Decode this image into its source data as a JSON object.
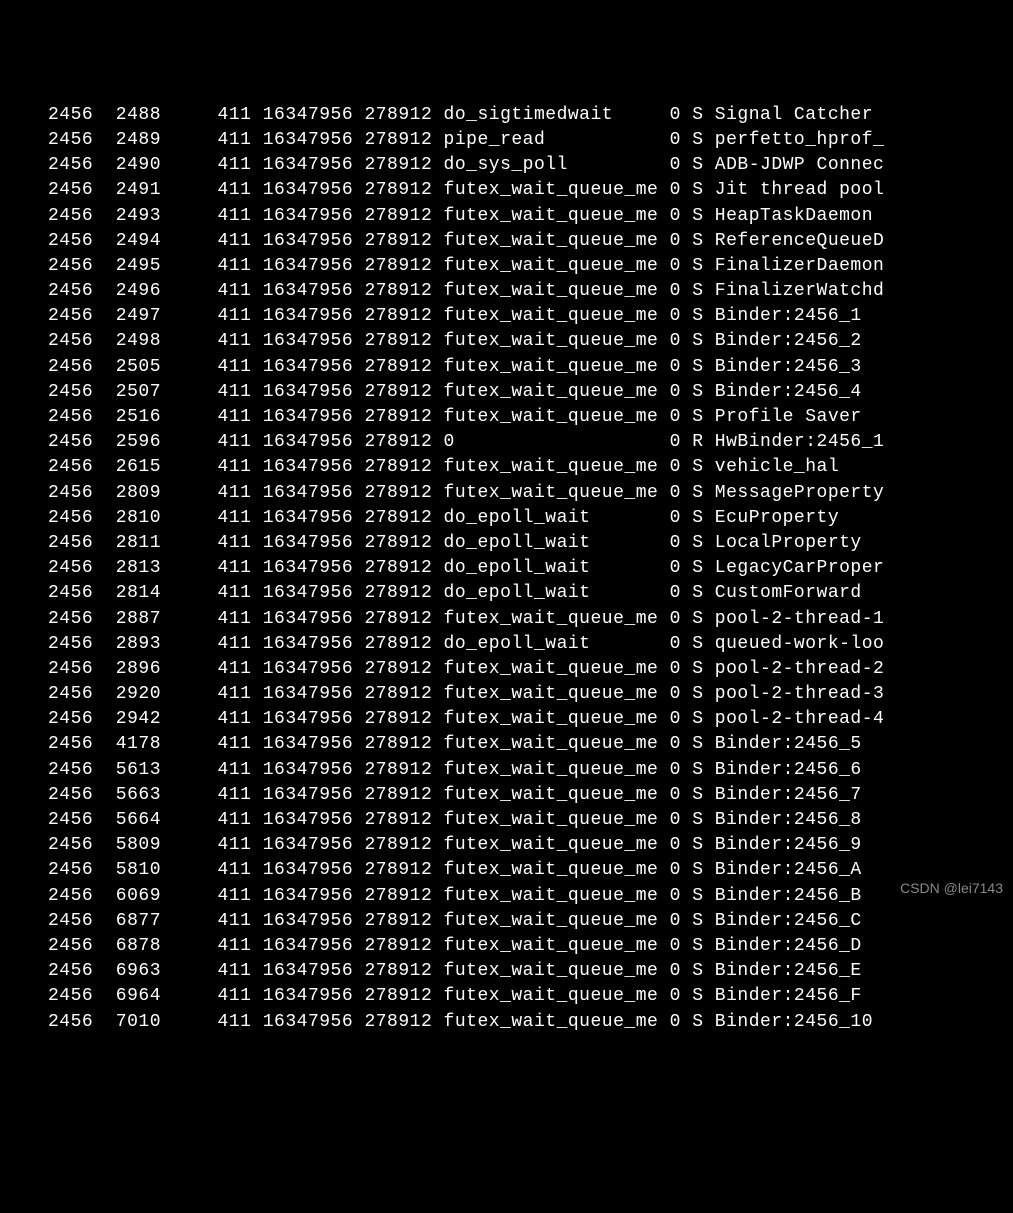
{
  "watermark": "CSDN @lei7143",
  "rows": [
    {
      "pid": "2456",
      "tid": "2488",
      "ppid": "411",
      "vsz": "16347956",
      "rss": "278912",
      "wchan": "do_sigtimedwait",
      "addr": "0",
      "stat": "S",
      "name": "Signal Catcher"
    },
    {
      "pid": "2456",
      "tid": "2489",
      "ppid": "411",
      "vsz": "16347956",
      "rss": "278912",
      "wchan": "pipe_read",
      "addr": "0",
      "stat": "S",
      "name": "perfetto_hprof_"
    },
    {
      "pid": "2456",
      "tid": "2490",
      "ppid": "411",
      "vsz": "16347956",
      "rss": "278912",
      "wchan": "do_sys_poll",
      "addr": "0",
      "stat": "S",
      "name": "ADB-JDWP Connec"
    },
    {
      "pid": "2456",
      "tid": "2491",
      "ppid": "411",
      "vsz": "16347956",
      "rss": "278912",
      "wchan": "futex_wait_queue_me",
      "addr": "0",
      "stat": "S",
      "name": "Jit thread pool"
    },
    {
      "pid": "2456",
      "tid": "2493",
      "ppid": "411",
      "vsz": "16347956",
      "rss": "278912",
      "wchan": "futex_wait_queue_me",
      "addr": "0",
      "stat": "S",
      "name": "HeapTaskDaemon"
    },
    {
      "pid": "2456",
      "tid": "2494",
      "ppid": "411",
      "vsz": "16347956",
      "rss": "278912",
      "wchan": "futex_wait_queue_me",
      "addr": "0",
      "stat": "S",
      "name": "ReferenceQueueD"
    },
    {
      "pid": "2456",
      "tid": "2495",
      "ppid": "411",
      "vsz": "16347956",
      "rss": "278912",
      "wchan": "futex_wait_queue_me",
      "addr": "0",
      "stat": "S",
      "name": "FinalizerDaemon"
    },
    {
      "pid": "2456",
      "tid": "2496",
      "ppid": "411",
      "vsz": "16347956",
      "rss": "278912",
      "wchan": "futex_wait_queue_me",
      "addr": "0",
      "stat": "S",
      "name": "FinalizerWatchd"
    },
    {
      "pid": "2456",
      "tid": "2497",
      "ppid": "411",
      "vsz": "16347956",
      "rss": "278912",
      "wchan": "futex_wait_queue_me",
      "addr": "0",
      "stat": "S",
      "name": "Binder:2456_1"
    },
    {
      "pid": "2456",
      "tid": "2498",
      "ppid": "411",
      "vsz": "16347956",
      "rss": "278912",
      "wchan": "futex_wait_queue_me",
      "addr": "0",
      "stat": "S",
      "name": "Binder:2456_2"
    },
    {
      "pid": "2456",
      "tid": "2505",
      "ppid": "411",
      "vsz": "16347956",
      "rss": "278912",
      "wchan": "futex_wait_queue_me",
      "addr": "0",
      "stat": "S",
      "name": "Binder:2456_3"
    },
    {
      "pid": "2456",
      "tid": "2507",
      "ppid": "411",
      "vsz": "16347956",
      "rss": "278912",
      "wchan": "futex_wait_queue_me",
      "addr": "0",
      "stat": "S",
      "name": "Binder:2456_4"
    },
    {
      "pid": "2456",
      "tid": "2516",
      "ppid": "411",
      "vsz": "16347956",
      "rss": "278912",
      "wchan": "futex_wait_queue_me",
      "addr": "0",
      "stat": "S",
      "name": "Profile Saver"
    },
    {
      "pid": "2456",
      "tid": "2596",
      "ppid": "411",
      "vsz": "16347956",
      "rss": "278912",
      "wchan": "0",
      "addr": "0",
      "stat": "R",
      "name": "HwBinder:2456_1"
    },
    {
      "pid": "2456",
      "tid": "2615",
      "ppid": "411",
      "vsz": "16347956",
      "rss": "278912",
      "wchan": "futex_wait_queue_me",
      "addr": "0",
      "stat": "S",
      "name": "vehicle_hal"
    },
    {
      "pid": "2456",
      "tid": "2809",
      "ppid": "411",
      "vsz": "16347956",
      "rss": "278912",
      "wchan": "futex_wait_queue_me",
      "addr": "0",
      "stat": "S",
      "name": "MessageProperty"
    },
    {
      "pid": "2456",
      "tid": "2810",
      "ppid": "411",
      "vsz": "16347956",
      "rss": "278912",
      "wchan": "do_epoll_wait",
      "addr": "0",
      "stat": "S",
      "name": "EcuProperty"
    },
    {
      "pid": "2456",
      "tid": "2811",
      "ppid": "411",
      "vsz": "16347956",
      "rss": "278912",
      "wchan": "do_epoll_wait",
      "addr": "0",
      "stat": "S",
      "name": "LocalProperty"
    },
    {
      "pid": "2456",
      "tid": "2813",
      "ppid": "411",
      "vsz": "16347956",
      "rss": "278912",
      "wchan": "do_epoll_wait",
      "addr": "0",
      "stat": "S",
      "name": "LegacyCarProper"
    },
    {
      "pid": "2456",
      "tid": "2814",
      "ppid": "411",
      "vsz": "16347956",
      "rss": "278912",
      "wchan": "do_epoll_wait",
      "addr": "0",
      "stat": "S",
      "name": "CustomForward"
    },
    {
      "pid": "2456",
      "tid": "2887",
      "ppid": "411",
      "vsz": "16347956",
      "rss": "278912",
      "wchan": "futex_wait_queue_me",
      "addr": "0",
      "stat": "S",
      "name": "pool-2-thread-1"
    },
    {
      "pid": "2456",
      "tid": "2893",
      "ppid": "411",
      "vsz": "16347956",
      "rss": "278912",
      "wchan": "do_epoll_wait",
      "addr": "0",
      "stat": "S",
      "name": "queued-work-loo"
    },
    {
      "pid": "2456",
      "tid": "2896",
      "ppid": "411",
      "vsz": "16347956",
      "rss": "278912",
      "wchan": "futex_wait_queue_me",
      "addr": "0",
      "stat": "S",
      "name": "pool-2-thread-2"
    },
    {
      "pid": "2456",
      "tid": "2920",
      "ppid": "411",
      "vsz": "16347956",
      "rss": "278912",
      "wchan": "futex_wait_queue_me",
      "addr": "0",
      "stat": "S",
      "name": "pool-2-thread-3"
    },
    {
      "pid": "2456",
      "tid": "2942",
      "ppid": "411",
      "vsz": "16347956",
      "rss": "278912",
      "wchan": "futex_wait_queue_me",
      "addr": "0",
      "stat": "S",
      "name": "pool-2-thread-4"
    },
    {
      "pid": "2456",
      "tid": "4178",
      "ppid": "411",
      "vsz": "16347956",
      "rss": "278912",
      "wchan": "futex_wait_queue_me",
      "addr": "0",
      "stat": "S",
      "name": "Binder:2456_5"
    },
    {
      "pid": "2456",
      "tid": "5613",
      "ppid": "411",
      "vsz": "16347956",
      "rss": "278912",
      "wchan": "futex_wait_queue_me",
      "addr": "0",
      "stat": "S",
      "name": "Binder:2456_6"
    },
    {
      "pid": "2456",
      "tid": "5663",
      "ppid": "411",
      "vsz": "16347956",
      "rss": "278912",
      "wchan": "futex_wait_queue_me",
      "addr": "0",
      "stat": "S",
      "name": "Binder:2456_7"
    },
    {
      "pid": "2456",
      "tid": "5664",
      "ppid": "411",
      "vsz": "16347956",
      "rss": "278912",
      "wchan": "futex_wait_queue_me",
      "addr": "0",
      "stat": "S",
      "name": "Binder:2456_8"
    },
    {
      "pid": "2456",
      "tid": "5809",
      "ppid": "411",
      "vsz": "16347956",
      "rss": "278912",
      "wchan": "futex_wait_queue_me",
      "addr": "0",
      "stat": "S",
      "name": "Binder:2456_9"
    },
    {
      "pid": "2456",
      "tid": "5810",
      "ppid": "411",
      "vsz": "16347956",
      "rss": "278912",
      "wchan": "futex_wait_queue_me",
      "addr": "0",
      "stat": "S",
      "name": "Binder:2456_A"
    },
    {
      "pid": "2456",
      "tid": "6069",
      "ppid": "411",
      "vsz": "16347956",
      "rss": "278912",
      "wchan": "futex_wait_queue_me",
      "addr": "0",
      "stat": "S",
      "name": "Binder:2456_B"
    },
    {
      "pid": "2456",
      "tid": "6877",
      "ppid": "411",
      "vsz": "16347956",
      "rss": "278912",
      "wchan": "futex_wait_queue_me",
      "addr": "0",
      "stat": "S",
      "name": "Binder:2456_C"
    },
    {
      "pid": "2456",
      "tid": "6878",
      "ppid": "411",
      "vsz": "16347956",
      "rss": "278912",
      "wchan": "futex_wait_queue_me",
      "addr": "0",
      "stat": "S",
      "name": "Binder:2456_D"
    },
    {
      "pid": "2456",
      "tid": "6963",
      "ppid": "411",
      "vsz": "16347956",
      "rss": "278912",
      "wchan": "futex_wait_queue_me",
      "addr": "0",
      "stat": "S",
      "name": "Binder:2456_E"
    },
    {
      "pid": "2456",
      "tid": "6964",
      "ppid": "411",
      "vsz": "16347956",
      "rss": "278912",
      "wchan": "futex_wait_queue_me",
      "addr": "0",
      "stat": "S",
      "name": "Binder:2456_F"
    },
    {
      "pid": "2456",
      "tid": "7010",
      "ppid": "411",
      "vsz": "16347956",
      "rss": "278912",
      "wchan": "futex_wait_queue_me",
      "addr": "0",
      "stat": "S",
      "name": "Binder:2456_10"
    }
  ]
}
